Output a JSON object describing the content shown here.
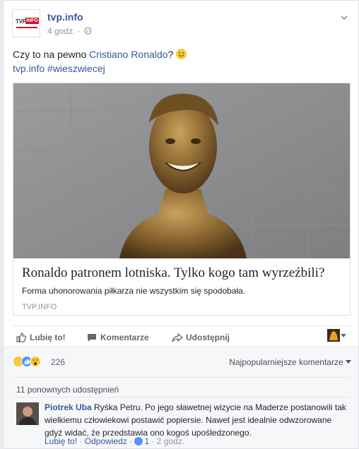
{
  "post": {
    "page_name": "tvp.info",
    "logo_text_tvp": "TVP",
    "logo_text_info": "INFO",
    "time": "4 godz. ·",
    "text_prefix": "Czy to na pewno ",
    "text_link": "Cristiano Ronaldo",
    "text_suffix": "? ",
    "text_line2_link": "tvp.info",
    "text_line2_hashtag": "#wieszwiecej"
  },
  "preview": {
    "title": "Ronaldo patronem lotniska. Tylko kogo tam wyrzeźbili?",
    "description": "Forma uhonorowania piłkarza nie wszystkim się spodobała.",
    "domain": "TVP.INFO"
  },
  "actions": {
    "like": "Lubię to!",
    "comment": "Komentarze",
    "share": "Udostępnij"
  },
  "reactions": {
    "count": "226",
    "sort_label": "Najpopularniejsze komentarze"
  },
  "shares": {
    "label": "11 ponownych udostępnień"
  },
  "comment": {
    "author": "Piotrek Uba",
    "text": "Ryśka Petru. Po jego sławetnej wizycie na Maderze postanowili tak wielkiemu człowiekowi postawić popiersie. Nawet jest idealnie odwzorowane gdyż widać, że przedstawia ono kogoś upośledzonego.",
    "like": "Lubię to!",
    "reply": "Odpowiedz",
    "likes": "1",
    "time": "2 godz."
  },
  "colors": {
    "link": "#365899",
    "muted": "#90949c",
    "brand_red": "#d0142c",
    "like_blue": "#5890ff"
  },
  "icons": [
    "chevron-down-icon",
    "globe-icon",
    "smiley-icon",
    "thumbs-up-icon",
    "comment-icon",
    "share-icon",
    "haha-icon",
    "like-icon",
    "wow-icon"
  ]
}
